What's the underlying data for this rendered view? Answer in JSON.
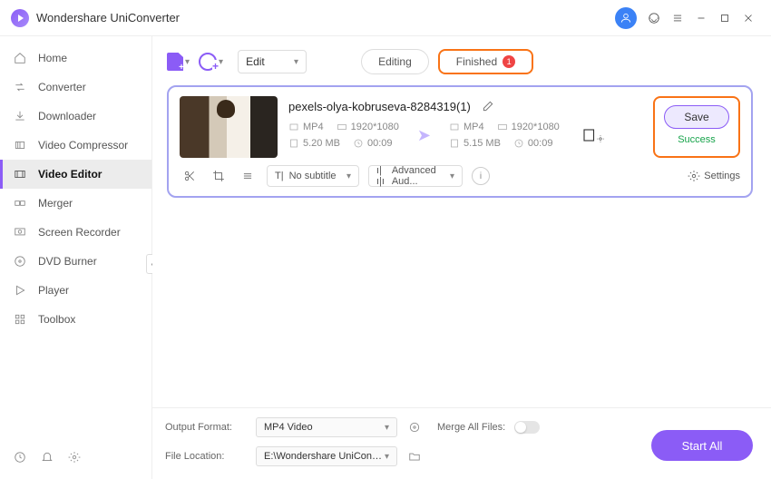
{
  "app": {
    "title": "Wondershare UniConverter"
  },
  "sidebar": {
    "items": [
      {
        "label": "Home"
      },
      {
        "label": "Converter"
      },
      {
        "label": "Downloader"
      },
      {
        "label": "Video Compressor"
      },
      {
        "label": "Video Editor"
      },
      {
        "label": "Merger"
      },
      {
        "label": "Screen Recorder"
      },
      {
        "label": "DVD Burner"
      },
      {
        "label": "Player"
      },
      {
        "label": "Toolbox"
      }
    ]
  },
  "toolbar": {
    "edit_dd": "Edit",
    "tab_editing": "Editing",
    "tab_finished": "Finished",
    "finished_badge": "1"
  },
  "item": {
    "filename": "pexels-olya-kobruseva-8284319(1)",
    "src": {
      "format": "MP4",
      "resolution": "1920*1080",
      "size": "5.20 MB",
      "duration": "00:09"
    },
    "dst": {
      "format": "MP4",
      "resolution": "1920*1080",
      "size": "5.15 MB",
      "duration": "00:09"
    },
    "subtitle_dd": "No subtitle",
    "audio_dd": "Advanced Aud...",
    "settings_label": "Settings",
    "save_label": "Save",
    "status": "Success"
  },
  "footer": {
    "output_format_label": "Output Format:",
    "output_format_value": "MP4 Video",
    "file_location_label": "File Location:",
    "file_location_value": "E:\\Wondershare UniConverter",
    "merge_label": "Merge All Files:",
    "start_all": "Start All"
  }
}
